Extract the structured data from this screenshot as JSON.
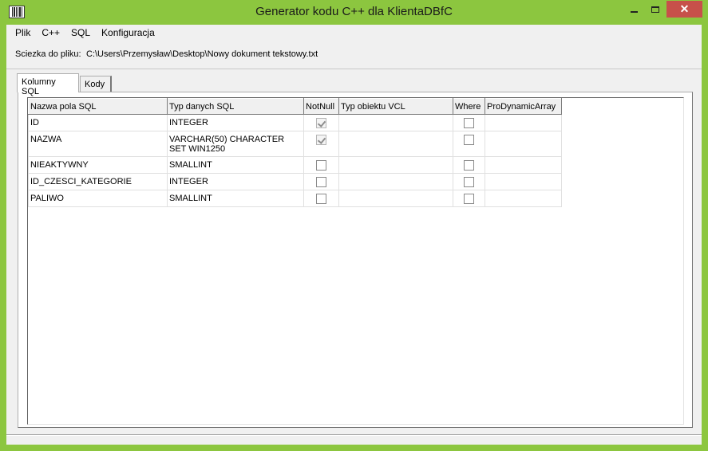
{
  "window": {
    "title": "Generator kodu C++ dla KlientaDBfC",
    "icon": "barcode-icon",
    "controls": {
      "minimize": "minimize-icon",
      "maximize": "maximize-icon",
      "close": "✕"
    }
  },
  "menu": {
    "items": [
      {
        "label": "Plik"
      },
      {
        "label": "C++"
      },
      {
        "label": "SQL"
      },
      {
        "label": "Konfiguracja"
      }
    ]
  },
  "path": {
    "label": "Sciezka do pliku:",
    "value": "C:\\Users\\Przemysław\\Desktop\\Nowy dokument tekstowy.txt"
  },
  "tabs": [
    {
      "label": "Kolumny SQL",
      "active": true
    },
    {
      "label": "Kody",
      "active": false
    }
  ],
  "grid": {
    "columns": [
      "Nazwa pola SQL",
      "Typ danych SQL",
      "NotNull",
      "Typ obiektu VCL",
      "Where",
      "ProDynamicArray"
    ],
    "rows": [
      {
        "name": "ID",
        "type": "INTEGER",
        "notnull": true,
        "vcl": "",
        "where": false,
        "pda": ""
      },
      {
        "name": "NAZWA",
        "type": "VARCHAR(50) CHARACTER SET WIN1250",
        "notnull": true,
        "vcl": "",
        "where": false,
        "pda": ""
      },
      {
        "name": "NIEAKTYWNY",
        "type": "SMALLINT",
        "notnull": false,
        "vcl": "",
        "where": false,
        "pda": ""
      },
      {
        "name": "ID_CZESCI_KATEGORIE",
        "type": "INTEGER",
        "notnull": false,
        "vcl": "",
        "where": false,
        "pda": ""
      },
      {
        "name": "PALIWO",
        "type": "SMALLINT",
        "notnull": false,
        "vcl": "",
        "where": false,
        "pda": ""
      }
    ]
  },
  "colors": {
    "frame": "#8cc63f",
    "close": "#c7504a",
    "desktop": "#1f6fb6"
  }
}
